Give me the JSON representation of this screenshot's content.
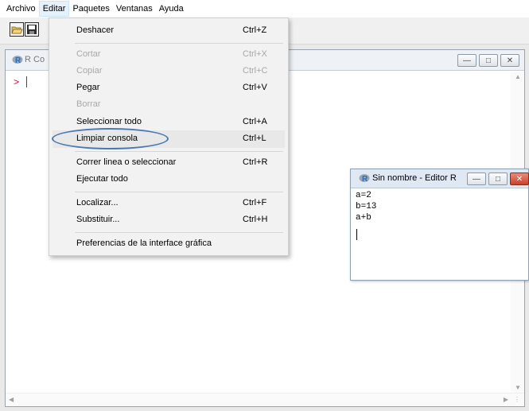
{
  "menubar": {
    "items": [
      "Archivo",
      "Editar",
      "Paquetes",
      "Ventanas",
      "Ayuda"
    ]
  },
  "toolbar": {
    "buttons": [
      "open-icon",
      "save-icon"
    ]
  },
  "console": {
    "title": "R Co",
    "prompt": ">",
    "logo": "R"
  },
  "editor": {
    "title": "Sin nombre - Editor R",
    "logo": "R",
    "lines": [
      "a=2",
      "b=13",
      "a+b"
    ]
  },
  "menu": {
    "items": [
      {
        "label": "Deshacer",
        "shortcut": "Ctrl+Z",
        "enabled": true
      },
      {
        "label": "Cortar",
        "shortcut": "Ctrl+X",
        "enabled": false
      },
      {
        "label": "Copiar",
        "shortcut": "Ctrl+C",
        "enabled": false
      },
      {
        "label": "Pegar",
        "shortcut": "Ctrl+V",
        "enabled": true
      },
      {
        "label": "Borrar",
        "shortcut": "",
        "enabled": false
      },
      {
        "label": "Seleccionar todo",
        "shortcut": "Ctrl+A",
        "enabled": true
      },
      {
        "label": "Limpiar consola",
        "shortcut": "Ctrl+L",
        "enabled": true,
        "highlighted": true
      },
      {
        "label": "Correr linea o seleccionar",
        "shortcut": "Ctrl+R",
        "enabled": true
      },
      {
        "label": "Ejecutar todo",
        "shortcut": "",
        "enabled": true
      },
      {
        "label": "Localizar...",
        "shortcut": "Ctrl+F",
        "enabled": true
      },
      {
        "label": "Substituir...",
        "shortcut": "Ctrl+H",
        "enabled": true
      },
      {
        "label": "Preferencias de la interface gráfica",
        "shortcut": "",
        "enabled": true
      }
    ]
  },
  "colors": {
    "prompt": "#e0002a",
    "highlight_ellipse": "#4a79b5",
    "r_logo": "#2c6bb5"
  }
}
